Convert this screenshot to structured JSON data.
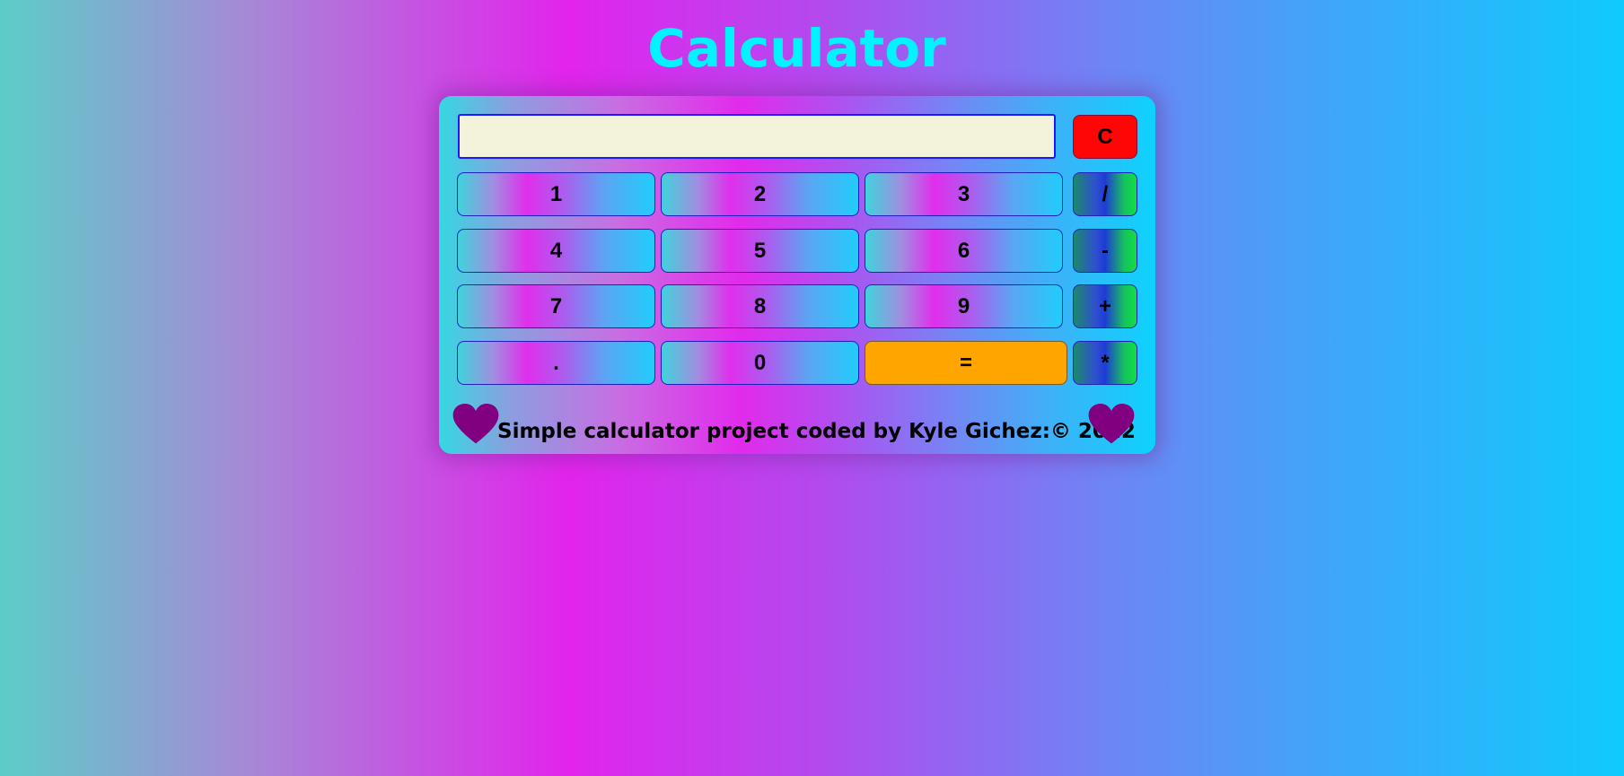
{
  "header": {
    "title": "Calculator"
  },
  "display": {
    "value": ""
  },
  "buttons": {
    "clear": "C",
    "rows": [
      [
        "1",
        "2",
        "3",
        "/"
      ],
      [
        "4",
        "5",
        "6",
        "-"
      ],
      [
        "7",
        "8",
        "9",
        "+"
      ],
      [
        ".",
        "0",
        "=",
        "*"
      ]
    ]
  },
  "footer": {
    "text": "Simple calculator project coded by Kyle Gichez:© 2022"
  },
  "colors": {
    "title": "#00f4ff",
    "clear_button": "#ff0606",
    "equals_button": "#ffa500",
    "display_bg": "#f3f3dc",
    "heart": "#800080"
  },
  "icons": {
    "footer_left": "heart-icon",
    "footer_right": "heart-icon"
  }
}
